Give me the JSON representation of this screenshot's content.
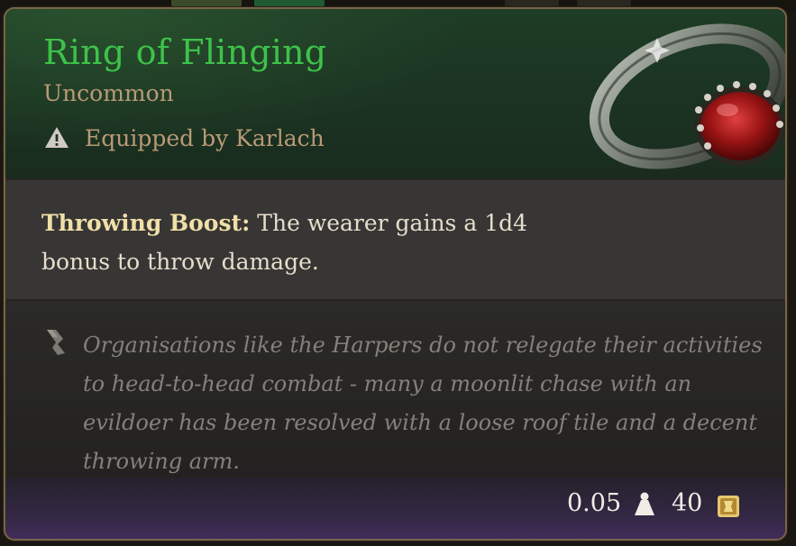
{
  "item": {
    "name": "Ring of Flinging",
    "rarity": "Uncommon",
    "equipped_text": "Equipped by Karlach",
    "boost_name": "Throwing Boost:",
    "boost_description": "The wearer gains a 1d4 bonus to throw damage.",
    "lore": "Organisations like the Harpers do not relegate their activities to head-to-head combat - many a moonlit chase with an evildoer has been resolved with a loose roof tile and a decent throwing arm.",
    "weight": "0.05",
    "price": "40"
  },
  "icons": {
    "equipped": "warning-triangle-icon",
    "lore": "scroll-quill-icon",
    "weight": "weight-icon",
    "price": "gold-coin-icon",
    "art": "ring-icon"
  },
  "colors": {
    "name_uncommon": "#3ec24a",
    "rarity_text": "#b89a76",
    "boost_name": "#f0dfa8",
    "lore_text": "#85807a",
    "frame": "#7a6446"
  }
}
